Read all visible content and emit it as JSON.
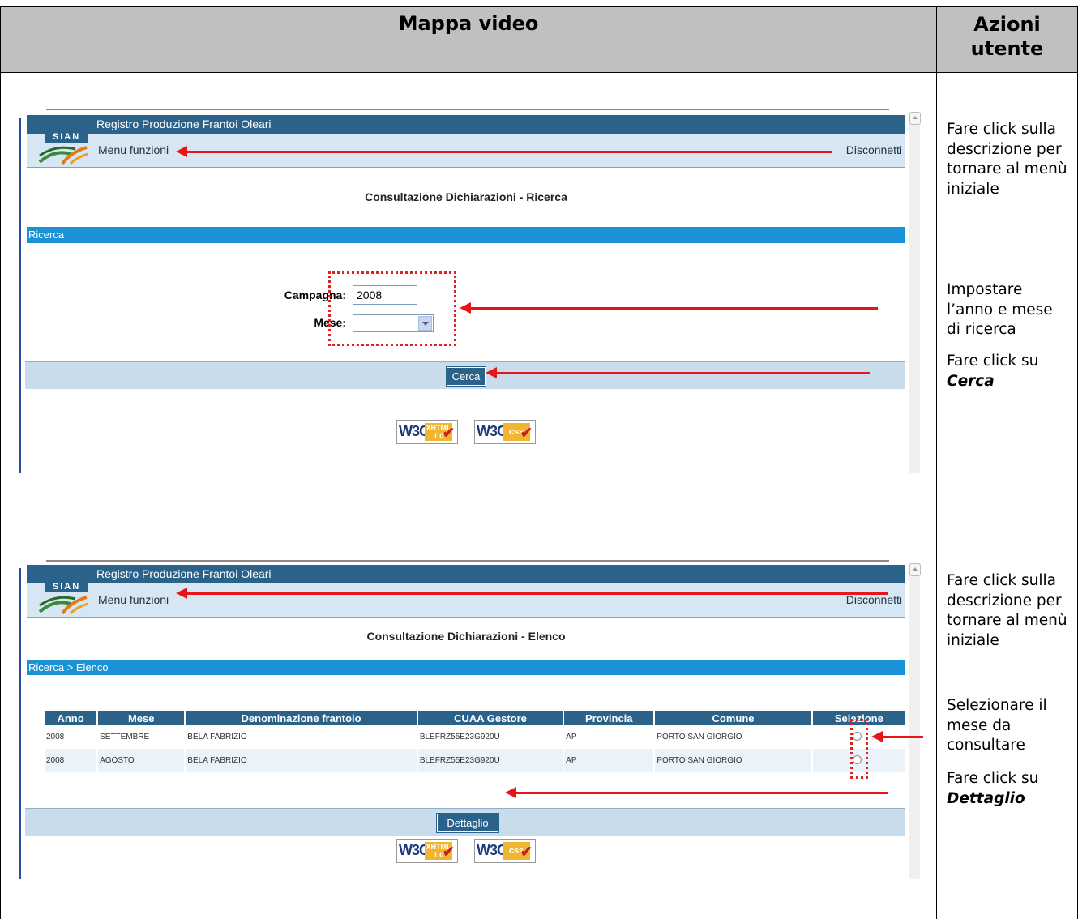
{
  "header": {
    "left_title": "Mappa video",
    "right_title": "Azioni utente"
  },
  "panel1": {
    "app_title": "Registro Produzione Frantoi Oleari",
    "logo_text": "SIAN",
    "menu_link": "Menu funzioni",
    "logout_link": "Disconnetti",
    "page_title": "Consultazione Dichiarazioni - Ricerca",
    "section_bar": "Ricerca",
    "campaign_label": "Campagna:",
    "campaign_value": "2008",
    "month_label": "Mese:",
    "month_value": "",
    "search_button": "Cerca",
    "w3c_xhtml": {
      "brand": "W3C",
      "tag_line1": "XHTML",
      "tag_line2": "1.0"
    },
    "w3c_css": {
      "brand": "W3C",
      "tag": "css"
    },
    "notes": {
      "back_to_menu": "Fare click sulla descrizione per tornare al menù iniziale",
      "set_year_month": "Impostare l’anno e mese di ricerca",
      "click_prefix": "Fare click su",
      "click_target": "Cerca"
    }
  },
  "panel2": {
    "app_title": "Registro Produzione Frantoi Oleari",
    "logo_text": "SIAN",
    "menu_link": "Menu funzioni",
    "logout_link": "Disconnetti",
    "page_title": "Consultazione Dichiarazioni - Elenco",
    "breadcrumb": "Ricerca > Elenco",
    "table": {
      "columns": [
        "Anno",
        "Mese",
        "Denominazione frantoio",
        "CUAA Gestore",
        "Provincia",
        "Comune",
        "Selezione"
      ],
      "rows": [
        [
          "2008",
          "SETTEMBRE",
          "BELA FABRIZIO",
          "BLEFRZ55E23G920U",
          "AP",
          "PORTO SAN GIORGIO"
        ],
        [
          "2008",
          "AGOSTO",
          "BELA FABRIZIO",
          "BLEFRZ55E23G920U",
          "AP",
          "PORTO SAN GIORGIO"
        ]
      ]
    },
    "detail_button": "Dettaglio",
    "w3c_xhtml": {
      "brand": "W3C",
      "tag_line1": "XHTML",
      "tag_line2": "1.0"
    },
    "w3c_css": {
      "brand": "W3C",
      "tag": "css"
    },
    "notes": {
      "back_to_menu": "Fare click sulla descrizione per tornare al menù iniziale",
      "select_month": "Selezionare il mese da consultare",
      "click_prefix": "Fare click su",
      "click_target": "Dettaglio"
    }
  },
  "colors": {
    "title_bar": "#2b6289",
    "section_bar": "#1a93d6",
    "arrow": "#e8141a",
    "header_bg": "#c0c0c0"
  }
}
